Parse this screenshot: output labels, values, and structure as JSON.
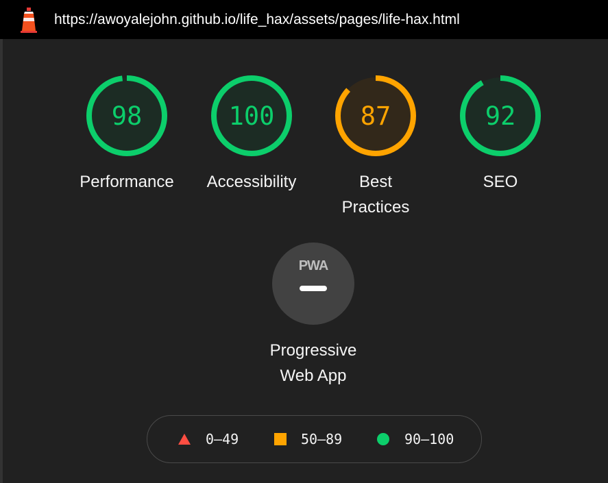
{
  "topbar": {
    "url": "https://awoyalejohn.github.io/life_hax/assets/pages/life-hax.html",
    "logo_icon": "lighthouse-icon"
  },
  "colors": {
    "pass": "#0cce6b",
    "average": "#ffa400",
    "fail": "#ff4e42",
    "background": "#212121"
  },
  "gauges": [
    {
      "score": 98,
      "score_text": "98",
      "label": "Performance",
      "status": "pass"
    },
    {
      "score": 100,
      "score_text": "100",
      "label": "Accessibility",
      "status": "pass"
    },
    {
      "score": 87,
      "score_text": "87",
      "label_line1": "Best",
      "label_line2": "Practices",
      "status": "average"
    },
    {
      "score": 92,
      "score_text": "92",
      "label": "SEO",
      "status": "pass"
    }
  ],
  "pwa": {
    "badge_text": "PWA",
    "label_line1": "Progressive",
    "label_line2": "Web App"
  },
  "legend": [
    {
      "icon": "triangle-icon",
      "range": "0–49",
      "color": "#ff4e42"
    },
    {
      "icon": "square-icon",
      "range": "50–89",
      "color": "#ffa400"
    },
    {
      "icon": "circle-icon",
      "range": "90–100",
      "color": "#0cce6b"
    }
  ]
}
